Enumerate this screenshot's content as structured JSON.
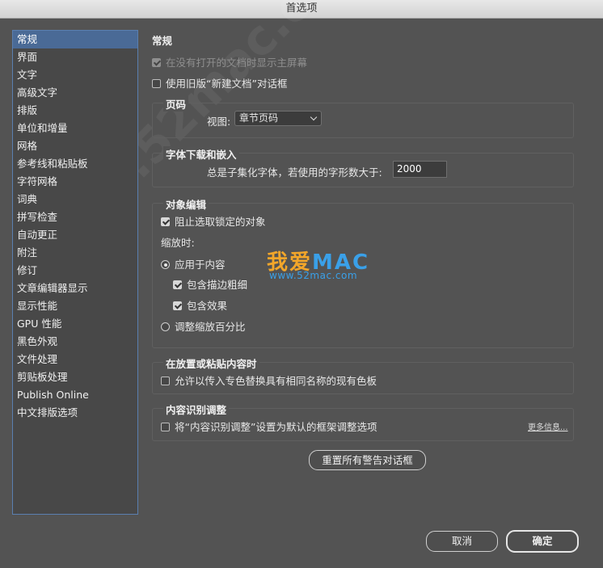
{
  "window": {
    "title": "首选项"
  },
  "sidebar": {
    "items": [
      {
        "label": "常规",
        "active": true
      },
      {
        "label": "界面"
      },
      {
        "label": "文字"
      },
      {
        "label": "高级文字"
      },
      {
        "label": "排版"
      },
      {
        "label": "单位和增量"
      },
      {
        "label": "网格"
      },
      {
        "label": "参考线和粘贴板"
      },
      {
        "label": "字符网格"
      },
      {
        "label": "词典"
      },
      {
        "label": "拼写检查"
      },
      {
        "label": "自动更正"
      },
      {
        "label": "附注"
      },
      {
        "label": "修订"
      },
      {
        "label": "文章编辑器显示"
      },
      {
        "label": "显示性能"
      },
      {
        "label": "GPU 性能"
      },
      {
        "label": "黑色外观"
      },
      {
        "label": "文件处理"
      },
      {
        "label": "剪贴板处理"
      },
      {
        "label": "Publish Online"
      },
      {
        "label": "中文排版选项"
      }
    ]
  },
  "general": {
    "title": "常规",
    "show_start_screen": {
      "label": "在没有打开的文档时显示主屏幕",
      "checked": true,
      "disabled": true
    },
    "legacy_new_doc": {
      "label": "使用旧版“新建文档”对话框",
      "checked": false
    }
  },
  "page_numbering": {
    "title": "页码",
    "view_label": "视图:",
    "view_value": "章节页码"
  },
  "font_download": {
    "title": "字体下载和嵌入",
    "subset_label": "总是子集化字体，若使用的字形数大于:",
    "subset_value": "2000"
  },
  "object_editing": {
    "title": "对象编辑",
    "prevent_locked": {
      "label": "阻止选取锁定的对象",
      "checked": true
    },
    "scaling_label": "缩放时:",
    "apply_to_content": {
      "label": "应用于内容",
      "selected": true
    },
    "include_stroke": {
      "label": "包含描边粗细",
      "checked": true
    },
    "include_effects": {
      "label": "包含效果",
      "checked": true
    },
    "adjust_percentage": {
      "label": "调整缩放百分比",
      "selected": false
    }
  },
  "paste": {
    "title": "在放置或粘贴内容时",
    "allow_spot": {
      "label": "允许以传入专色替换具有相同名称的现有色板",
      "checked": false
    }
  },
  "content_aware": {
    "title": "内容识别调整",
    "set_default": {
      "label": "将“内容识别调整”设置为默认的框架调整选项",
      "checked": false
    },
    "more_info": "更多信息..."
  },
  "buttons": {
    "reset_warnings": "重置所有警告对话框",
    "cancel": "取消",
    "ok": "确定"
  },
  "watermark": {
    "brand_cn": "我爱",
    "brand_en": "MAC",
    "url": "www.52mac.com",
    "bg_text": "www.52mac.com",
    "colors": {
      "orange": "#f2a62a",
      "blue": "#3aa0e8"
    }
  },
  "colors": {
    "background": "#535353",
    "sidebar_bg": "#484848",
    "selection": "#4a6a96"
  }
}
